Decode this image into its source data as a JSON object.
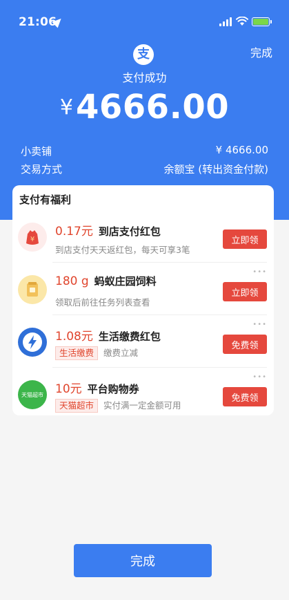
{
  "status_bar": {
    "time": "21:06",
    "battery_level": 1.0
  },
  "header": {
    "done_label": "完成",
    "logo_char": "支",
    "success_text": "支付成功",
    "currency_symbol": "¥",
    "amount": "4666.00",
    "merchant_label": "小卖铺",
    "merchant_amount": "¥ 4666.00",
    "pay_method_label": "交易方式",
    "pay_method_value": "余额宝 (转出资金付款)"
  },
  "benefits": {
    "title": "支付有福利",
    "items": [
      {
        "highlight": "0.17元",
        "name": "到店支付红包",
        "tag": "",
        "subtitle": "到店支付天天返红包，每天可享3笔",
        "button": "立即领",
        "icon": "red-envelope-icon",
        "icon_char": "¥",
        "icon_bg": "#fdeceb",
        "icon_fg": "#e5483d"
      },
      {
        "highlight": "180 g",
        "name": "蚂蚁庄园饲料",
        "tag": "",
        "subtitle": "领取后前往任务列表查看",
        "button": "立即领",
        "icon": "feed-bag-icon",
        "icon_char": "",
        "icon_bg": "#fbe7a8",
        "icon_fg": "#d8a640"
      },
      {
        "highlight": "1.08元",
        "name": "生活缴费红包",
        "tag": "生活缴费",
        "subtitle": "缴费立减",
        "button": "免费领",
        "icon": "lightning-bolt-icon",
        "icon_char": "⚡",
        "icon_bg": "#2f6fd8",
        "icon_fg": "#ffffff"
      },
      {
        "highlight": "10元",
        "name": "平台购物券",
        "tag": "天猫超市",
        "subtitle": "实付满一定金额可用",
        "button": "免费领",
        "icon": "tmall-supermarket-icon",
        "icon_char": "天猫超市",
        "icon_bg": "#3cb54a",
        "icon_fg": "#ffffff"
      }
    ]
  },
  "footer": {
    "done_label": "完成"
  },
  "colors": {
    "brand_blue": "#3b7df0",
    "accent_red": "#e5483d",
    "highlight_red": "#e0452d"
  }
}
